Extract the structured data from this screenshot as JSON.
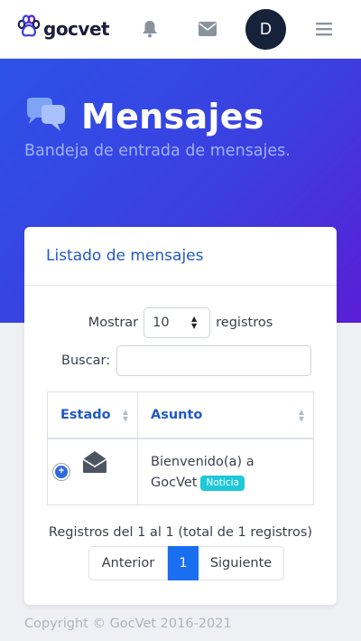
{
  "app": {
    "brand": "gocvet"
  },
  "header": {
    "avatar_initial": "D"
  },
  "hero": {
    "title": "Mensajes",
    "subtitle": "Bandeja de entrada de mensajes."
  },
  "card": {
    "title": "Listado de mensajes"
  },
  "controls": {
    "show_label": "Mostrar",
    "page_size": "10",
    "records_label": "registros",
    "search_label": "Buscar:",
    "search_value": ""
  },
  "table": {
    "columns": [
      "Estado",
      "Asunto"
    ],
    "rows": [
      {
        "subject_line1": "Bienvenido(a) a",
        "subject_line2": "GocVet",
        "badge": "Noticia"
      }
    ]
  },
  "pagination": {
    "info": "Registros del 1 al 1 (total de 1 registros)",
    "prev": "Anterior",
    "current": "1",
    "next": "Siguiente"
  },
  "footer": {
    "copyright": "Copyright © GocVet 2016-2021"
  },
  "icons": {
    "logo": "paw-icon",
    "notifications": "bell-icon",
    "messages": "envelope-icon",
    "menu": "hamburger-icon",
    "hero": "comments-icon",
    "status": "envelope-open-icon",
    "expand": "plus-circle-icon"
  },
  "colors": {
    "accent": "#2259c4",
    "badge": "#1fc8d8",
    "pager_active": "#1a6ef0",
    "hero_start": "#2d52e8",
    "hero_end": "#5a1ed6"
  }
}
